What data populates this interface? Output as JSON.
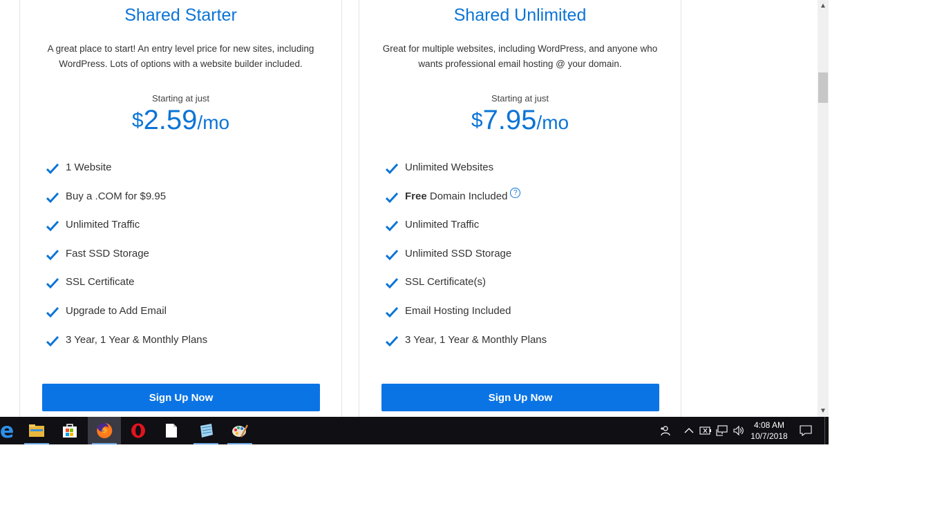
{
  "plans": [
    {
      "title": "Shared Starter",
      "description": "A great place to start! An entry level price for new sites, including WordPress. Lots of options with a website builder included.",
      "starting_label": "Starting at just",
      "currency": "$",
      "amount": "2.59",
      "period": "/mo",
      "features": [
        {
          "bold": "",
          "text": "1 Website"
        },
        {
          "bold": "",
          "text": "Buy a .COM for $9.95"
        },
        {
          "bold": "",
          "text": "Unlimited Traffic"
        },
        {
          "bold": "",
          "text": "Fast SSD Storage"
        },
        {
          "bold": "",
          "text": "SSL Certificate"
        },
        {
          "bold": "",
          "text": "Upgrade to Add Email"
        },
        {
          "bold": "",
          "text": "3 Year, 1 Year & Monthly Plans"
        }
      ],
      "button_label": "Sign Up Now"
    },
    {
      "title": "Shared Unlimited",
      "description": "Great for multiple websites, including WordPress, and anyone who wants professional email hosting @ your domain.",
      "starting_label": "Starting at just",
      "currency": "$",
      "amount": "7.95",
      "period": "/mo",
      "features": [
        {
          "bold": "",
          "text": "Unlimited Websites"
        },
        {
          "bold": "Free",
          "text": " Domain Included",
          "help": "?"
        },
        {
          "bold": "",
          "text": "Unlimited Traffic"
        },
        {
          "bold": "",
          "text": "Unlimited SSD Storage"
        },
        {
          "bold": "",
          "text": "SSL Certificate(s)"
        },
        {
          "bold": "",
          "text": "Email Hosting Included"
        },
        {
          "bold": "",
          "text": "3 Year, 1 Year & Monthly Plans"
        }
      ],
      "button_label": "Sign Up Now"
    }
  ],
  "colors": {
    "accent": "#0b74d6",
    "button": "#0b74e5",
    "taskbar": "#0f0f14"
  },
  "taskbar": {
    "apps": [
      {
        "name": "edge-icon",
        "active": false,
        "underline": false
      },
      {
        "name": "file-explorer-icon",
        "active": false,
        "underline": true
      },
      {
        "name": "store-icon",
        "active": false,
        "underline": false
      },
      {
        "name": "firefox-icon",
        "active": true,
        "underline": true
      },
      {
        "name": "opera-icon",
        "active": false,
        "underline": false
      },
      {
        "name": "document-icon",
        "active": false,
        "underline": false
      },
      {
        "name": "notepad-icon",
        "active": false,
        "underline": true
      },
      {
        "name": "paint-icon",
        "active": false,
        "underline": true
      }
    ],
    "clock": {
      "time": "4:08 AM",
      "date": "10/7/2018"
    }
  }
}
